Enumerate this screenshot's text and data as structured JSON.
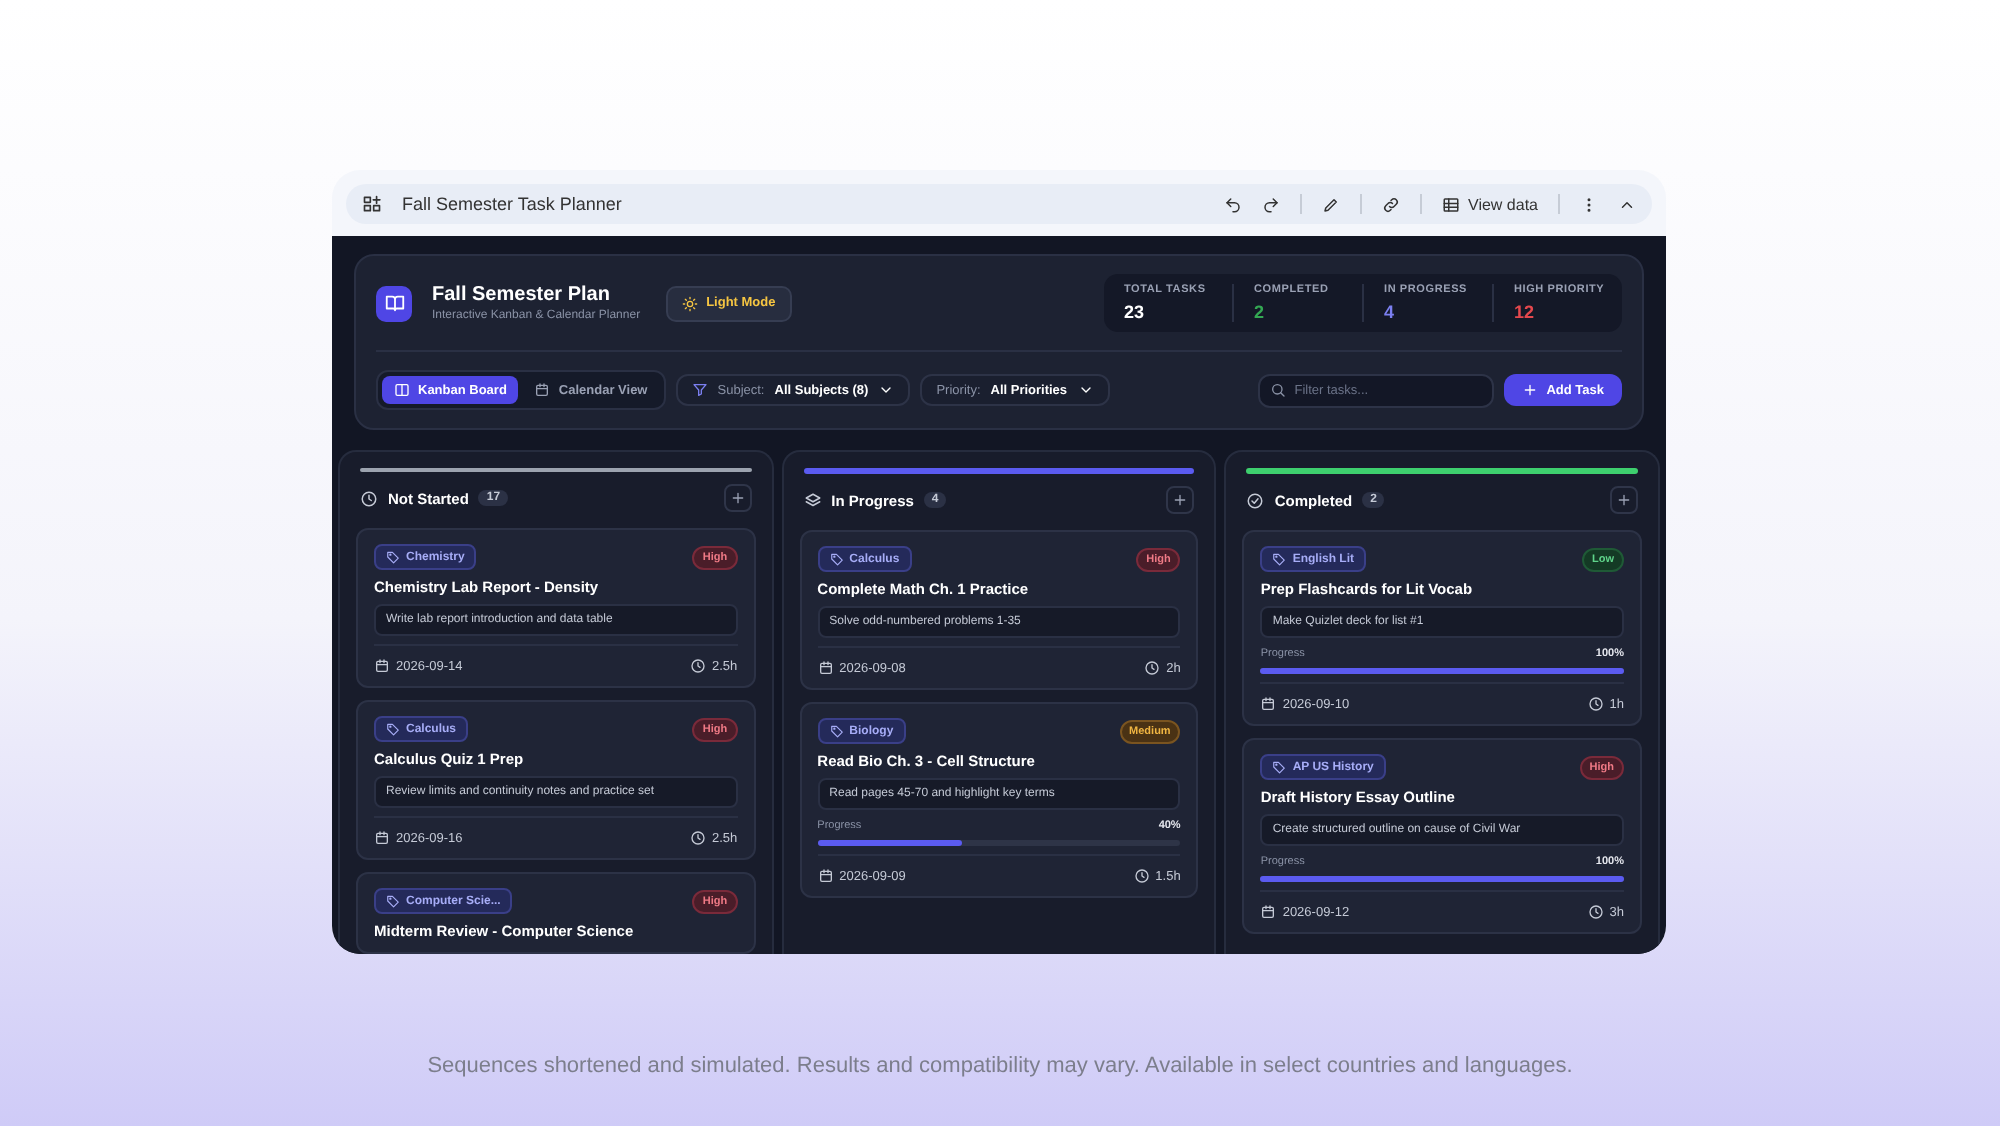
{
  "toolbar": {
    "title": "Fall Semester Task Planner",
    "view_data": "View data"
  },
  "header": {
    "title": "Fall Semester Plan",
    "subtitle": "Interactive Kanban & Calendar Planner",
    "theme_button": "Light Mode",
    "stats": [
      {
        "label": "TOTAL TASKS",
        "value": "23",
        "color": "#ffffff"
      },
      {
        "label": "COMPLETED",
        "value": "2",
        "color": "#34a853"
      },
      {
        "label": "IN PROGRESS",
        "value": "4",
        "color": "#7b7ff0"
      },
      {
        "label": "HIGH PRIORITY",
        "value": "12",
        "color": "#e5484d"
      }
    ]
  },
  "views": [
    {
      "label": "Kanban Board",
      "selected": true
    },
    {
      "label": "Calendar View",
      "selected": false
    }
  ],
  "filters": [
    {
      "label": "Subject:",
      "value": "All Subjects (8)",
      "kind": "funnel"
    },
    {
      "label": "Priority:",
      "value": "All Priorities",
      "kind": "plain"
    }
  ],
  "search": {
    "placeholder": "Filter tasks..."
  },
  "add_button": "Add Task",
  "columns": [
    {
      "title": "Not Started",
      "count": "17",
      "color": "#9ca3af",
      "kind": "clock",
      "cards": [
        {
          "tag": "Chemistry",
          "priority": "High",
          "kind": "high",
          "title": "Chemistry Lab Report - Density",
          "description": "Write lab report introduction and data table",
          "date": "2026-09-14",
          "hours": "2.5h"
        },
        {
          "tag": "Calculus",
          "priority": "High",
          "kind": "high",
          "title": "Calculus Quiz 1 Prep",
          "description": "Review limits and continuity notes and practice set",
          "date": "2026-09-16",
          "hours": "2.5h"
        },
        {
          "tag": "Computer Scie...",
          "priority": "High",
          "kind": "high",
          "title": "Midterm Review - Computer Science"
        }
      ]
    },
    {
      "title": "In Progress",
      "count": "4",
      "color": "#5b5bf0",
      "kind": "layers",
      "cards": [
        {
          "tag": "Calculus",
          "priority": "High",
          "kind": "high",
          "title": "Complete Math Ch. 1 Practice",
          "description": "Solve odd-numbered problems 1-35",
          "date": "2026-09-08",
          "hours": "2h"
        },
        {
          "tag": "Biology",
          "priority": "Medium",
          "kind": "medium",
          "title": "Read Bio Ch. 3 - Cell Structure",
          "description": "Read pages 45-70 and highlight key terms",
          "progress_label": "Progress",
          "progress_reading": "40%",
          "level": 0.4,
          "date": "2026-09-09",
          "hours": "1.5h"
        }
      ]
    },
    {
      "title": "Completed",
      "count": "2",
      "color": "#3ecf6e",
      "kind": "check",
      "cards": [
        {
          "tag": "English Lit",
          "priority": "Low",
          "kind": "low",
          "title": "Prep Flashcards for Lit Vocab",
          "description": "Make Quizlet deck for list #1",
          "progress_label": "Progress",
          "progress_reading": "100%",
          "level": 1,
          "date": "2026-09-10",
          "hours": "1h"
        },
        {
          "tag": "AP US History",
          "priority": "High",
          "kind": "high",
          "title": "Draft History Essay Outline",
          "description": "Create structured outline on cause of Civil War",
          "progress_label": "Progress",
          "progress_reading": "100%",
          "level": 1,
          "date": "2026-09-12",
          "hours": "3h"
        }
      ]
    }
  ],
  "footer": "Sequences shortened and simulated. Results and compatibility may vary. Available in select countries and languages."
}
